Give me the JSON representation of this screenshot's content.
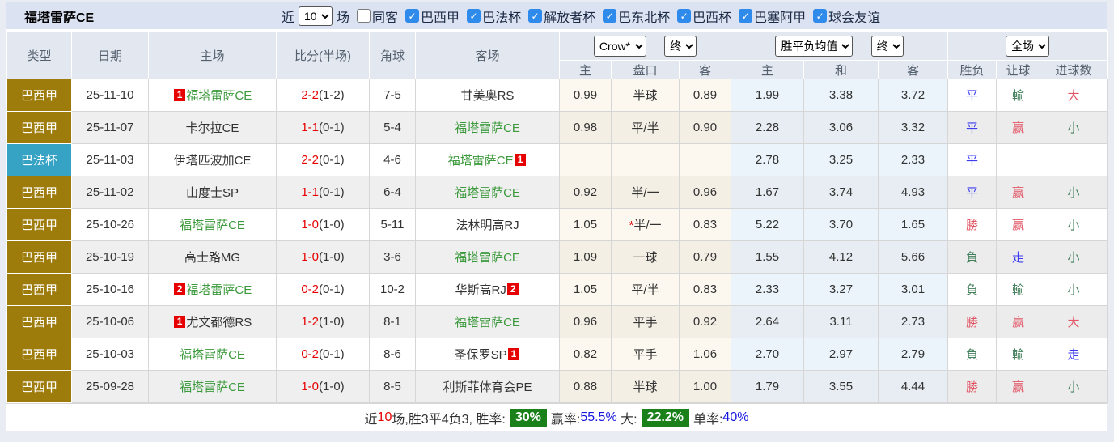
{
  "title": "福塔雷萨CE",
  "filters": {
    "recent_label": "近",
    "recent_value": "10",
    "games_label": "场",
    "same_venue": {
      "label": "同客",
      "checked": false
    },
    "leagues": [
      {
        "label": "巴西甲",
        "checked": true
      },
      {
        "label": "巴法杯",
        "checked": true
      },
      {
        "label": "解放者杯",
        "checked": true
      },
      {
        "label": "巴东北杯",
        "checked": true
      },
      {
        "label": "巴西杯",
        "checked": true
      },
      {
        "label": "巴塞阿甲",
        "checked": true
      },
      {
        "label": "球会友谊",
        "checked": true
      }
    ]
  },
  "selectors": {
    "asian_company": "Crow*",
    "asian_time": "终",
    "europe_company": "胜平负均值",
    "europe_time": "终",
    "result_scope": "全场"
  },
  "columns": {
    "type": "类型",
    "date": "日期",
    "home": "主场",
    "score": "比分(半场)",
    "corners": "角球",
    "away": "客场",
    "ah_home": "主",
    "ah_line": "盘口",
    "ah_away": "客",
    "eu_home": "主",
    "eu_draw": "和",
    "eu_away": "客",
    "outcome": "胜负",
    "handicap": "让球",
    "goals": "进球数"
  },
  "colors": {
    "league_bg": "#9e7c0c",
    "cup_bg": "#36a3c4",
    "self_team": "#3c9a3c",
    "score_red": "#e60000",
    "badge_bg": "#e60000",
    "win_red": "#e25565",
    "lose_green": "#42805c",
    "draw_blue": "#3d3df0",
    "summary_badge_bg": "#1a801a",
    "summary_blue": "#1515e0"
  },
  "rows": [
    {
      "league": "巴西甲",
      "league_type": "league",
      "date": "25-11-10",
      "home": {
        "name": "福塔雷萨CE",
        "self": true,
        "badge_before": "1"
      },
      "score": {
        "full": "2-2",
        "half": "(1-2)"
      },
      "corners": "7-5",
      "away": {
        "name": "甘美奥RS"
      },
      "asian": {
        "home": "0.99",
        "line": "半球",
        "star": false,
        "away": "0.89"
      },
      "europe": {
        "home": "1.99",
        "draw": "3.38",
        "away": "3.72"
      },
      "results": {
        "outcome": "平",
        "handicap": "輸",
        "goals": "大"
      }
    },
    {
      "league": "巴西甲",
      "league_type": "league",
      "date": "25-11-07",
      "home": {
        "name": "卡尔拉CE"
      },
      "score": {
        "full": "1-1",
        "half": "(0-1)"
      },
      "corners": "5-4",
      "away": {
        "name": "福塔雷萨CE",
        "self": true
      },
      "asian": {
        "home": "0.98",
        "line": "平/半",
        "star": false,
        "away": "0.90"
      },
      "europe": {
        "home": "2.28",
        "draw": "3.06",
        "away": "3.32"
      },
      "results": {
        "outcome": "平",
        "handicap": "赢",
        "goals": "小"
      }
    },
    {
      "league": "巴法杯",
      "league_type": "cup",
      "date": "25-11-03",
      "home": {
        "name": "伊塔匹波加CE"
      },
      "score": {
        "full": "2-2",
        "half": "(0-1)"
      },
      "corners": "4-6",
      "away": {
        "name": "福塔雷萨CE",
        "self": true,
        "badge_after": "1"
      },
      "asian": {
        "home": "",
        "line": "",
        "star": false,
        "away": ""
      },
      "europe": {
        "home": "2.78",
        "draw": "3.25",
        "away": "2.33"
      },
      "results": {
        "outcome": "平",
        "handicap": "",
        "goals": ""
      }
    },
    {
      "league": "巴西甲",
      "league_type": "league",
      "date": "25-11-02",
      "home": {
        "name": "山度士SP"
      },
      "score": {
        "full": "1-1",
        "half": "(0-1)"
      },
      "corners": "6-4",
      "away": {
        "name": "福塔雷萨CE",
        "self": true
      },
      "asian": {
        "home": "0.92",
        "line": "半/一",
        "star": false,
        "away": "0.96"
      },
      "europe": {
        "home": "1.67",
        "draw": "3.74",
        "away": "4.93"
      },
      "results": {
        "outcome": "平",
        "handicap": "赢",
        "goals": "小"
      }
    },
    {
      "league": "巴西甲",
      "league_type": "league",
      "date": "25-10-26",
      "home": {
        "name": "福塔雷萨CE",
        "self": true
      },
      "score": {
        "full": "1-0",
        "half": "(1-0)"
      },
      "corners": "5-11",
      "away": {
        "name": "法林明高RJ"
      },
      "asian": {
        "home": "1.05",
        "line": "半/一",
        "star": true,
        "away": "0.83"
      },
      "europe": {
        "home": "5.22",
        "draw": "3.70",
        "away": "1.65"
      },
      "results": {
        "outcome": "勝",
        "handicap": "赢",
        "goals": "小"
      }
    },
    {
      "league": "巴西甲",
      "league_type": "league",
      "date": "25-10-19",
      "home": {
        "name": "高士路MG"
      },
      "score": {
        "full": "1-0",
        "half": "(1-0)"
      },
      "corners": "3-6",
      "away": {
        "name": "福塔雷萨CE",
        "self": true
      },
      "asian": {
        "home": "1.09",
        "line": "一球",
        "star": false,
        "away": "0.79"
      },
      "europe": {
        "home": "1.55",
        "draw": "4.12",
        "away": "5.66"
      },
      "results": {
        "outcome": "負",
        "handicap": "走",
        "goals": "小"
      }
    },
    {
      "league": "巴西甲",
      "league_type": "league",
      "date": "25-10-16",
      "home": {
        "name": "福塔雷萨CE",
        "self": true,
        "badge_before": "2"
      },
      "score": {
        "full": "0-2",
        "half": "(0-1)"
      },
      "corners": "10-2",
      "away": {
        "name": "华斯高RJ",
        "badge_after": "2"
      },
      "asian": {
        "home": "1.05",
        "line": "平/半",
        "star": false,
        "away": "0.83"
      },
      "europe": {
        "home": "2.33",
        "draw": "3.27",
        "away": "3.01"
      },
      "results": {
        "outcome": "負",
        "handicap": "輸",
        "goals": "小"
      }
    },
    {
      "league": "巴西甲",
      "league_type": "league",
      "date": "25-10-06",
      "home": {
        "name": "尤文都德RS",
        "badge_before": "1"
      },
      "score": {
        "full": "1-2",
        "half": "(1-0)"
      },
      "corners": "8-1",
      "away": {
        "name": "福塔雷萨CE",
        "self": true
      },
      "asian": {
        "home": "0.96",
        "line": "平手",
        "star": false,
        "away": "0.92"
      },
      "europe": {
        "home": "2.64",
        "draw": "3.11",
        "away": "2.73"
      },
      "results": {
        "outcome": "勝",
        "handicap": "赢",
        "goals": "大"
      }
    },
    {
      "league": "巴西甲",
      "league_type": "league",
      "date": "25-10-03",
      "home": {
        "name": "福塔雷萨CE",
        "self": true
      },
      "score": {
        "full": "0-2",
        "half": "(0-1)"
      },
      "corners": "8-6",
      "away": {
        "name": "圣保罗SP",
        "badge_after": "1"
      },
      "asian": {
        "home": "0.82",
        "line": "平手",
        "star": false,
        "away": "1.06"
      },
      "europe": {
        "home": "2.70",
        "draw": "2.97",
        "away": "2.79"
      },
      "results": {
        "outcome": "負",
        "handicap": "輸",
        "goals": "走"
      }
    },
    {
      "league": "巴西甲",
      "league_type": "league",
      "date": "25-09-28",
      "home": {
        "name": "福塔雷萨CE",
        "self": true
      },
      "score": {
        "full": "1-0",
        "half": "(1-0)"
      },
      "corners": "8-5",
      "away": {
        "name": "利斯菲体育会PE"
      },
      "asian": {
        "home": "0.88",
        "line": "半球",
        "star": false,
        "away": "1.00"
      },
      "europe": {
        "home": "1.79",
        "draw": "3.55",
        "away": "4.44"
      },
      "results": {
        "outcome": "勝",
        "handicap": "赢",
        "goals": "小"
      }
    }
  ],
  "summary": {
    "segments": [
      {
        "t": "近"
      },
      {
        "t": "10",
        "c": "red"
      },
      {
        "t": "场,胜3平4负3, 胜率:"
      },
      {
        "t": "30%",
        "badge": true
      },
      {
        "t": "赢率:"
      },
      {
        "t": "55.5%",
        "c": "blue"
      },
      {
        "t": " 大:"
      },
      {
        "t": "22.2%",
        "badge": true
      },
      {
        "t": "单率:"
      },
      {
        "t": "40%",
        "c": "blue"
      }
    ]
  }
}
